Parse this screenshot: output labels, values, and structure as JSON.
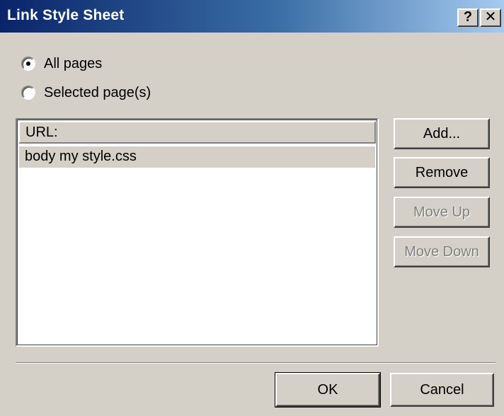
{
  "window": {
    "title": "Link Style Sheet",
    "help_glyph": "?",
    "close_glyph": "✕"
  },
  "scope": {
    "options": [
      {
        "label": "All pages",
        "checked": true
      },
      {
        "label": "Selected page(s)",
        "checked": false
      }
    ]
  },
  "list": {
    "header": "URL:",
    "items": [
      "body my style.css"
    ]
  },
  "side_buttons": {
    "add": "Add...",
    "remove": "Remove",
    "move_up": "Move Up",
    "move_down": "Move Down"
  },
  "footer": {
    "ok": "OK",
    "cancel": "Cancel"
  },
  "colors": {
    "face": "#d4d0c8",
    "titlebar_start": "#0a246a",
    "titlebar_end": "#a6caf0"
  }
}
